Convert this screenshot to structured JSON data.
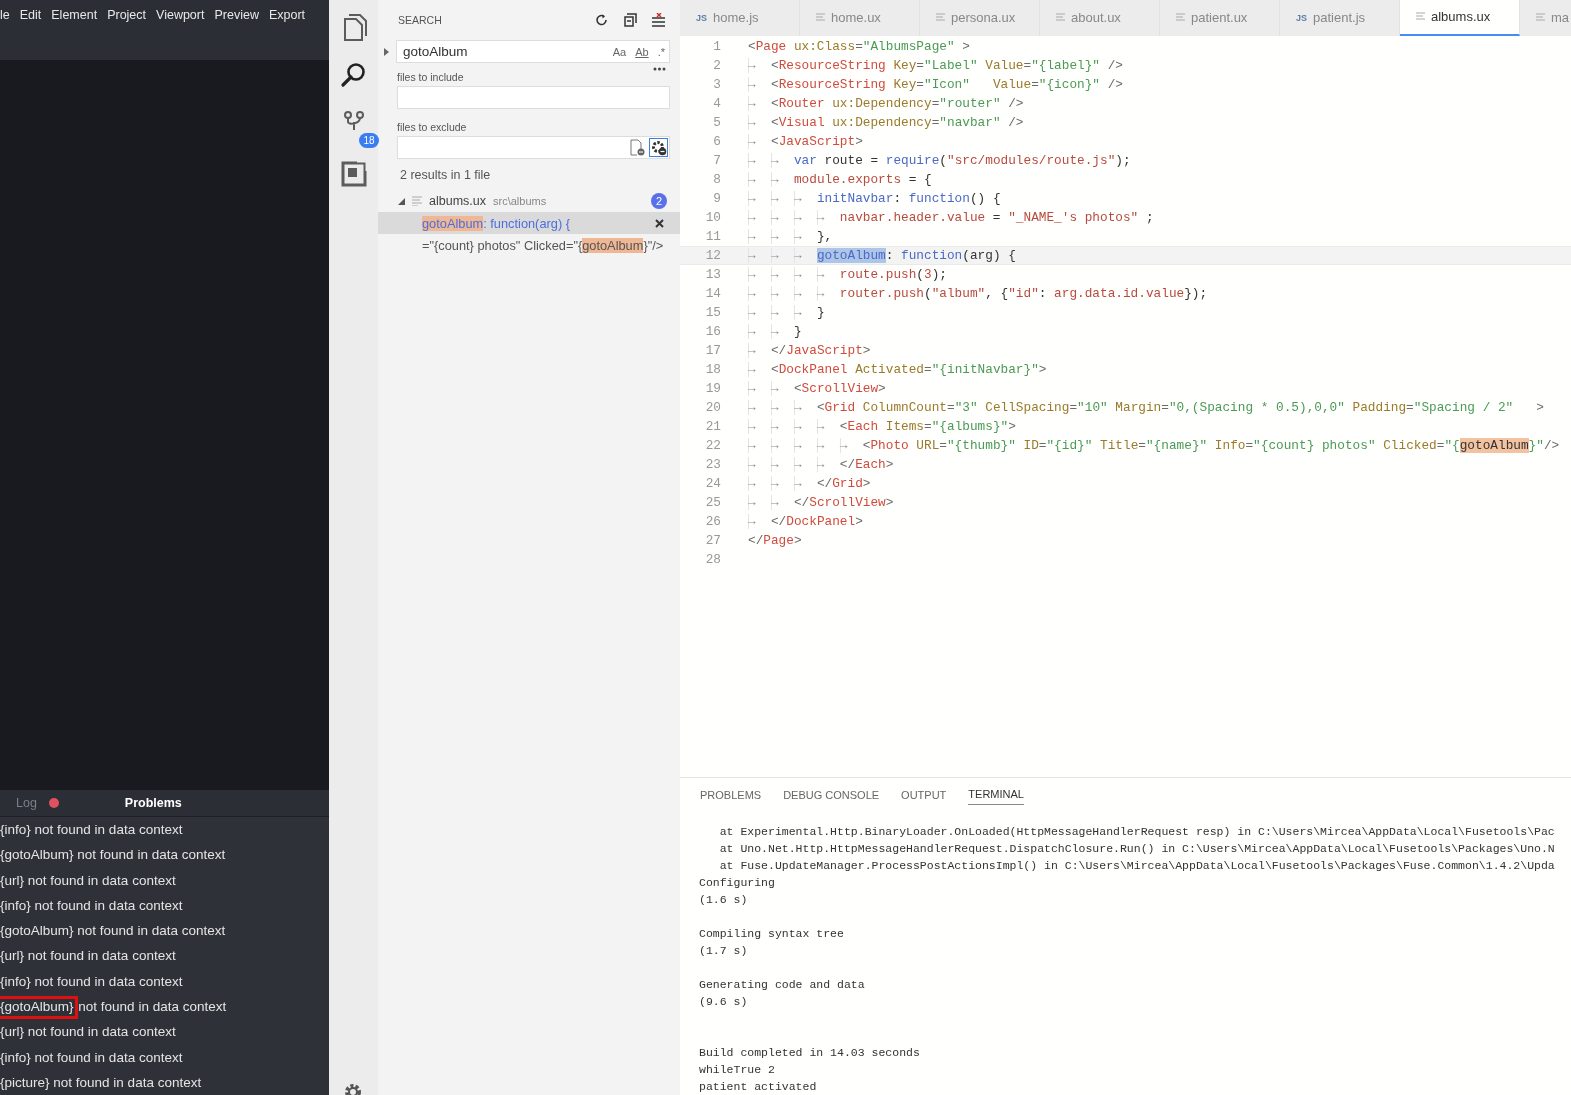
{
  "designer": {
    "menu": [
      {
        "label": "le"
      },
      {
        "label": "Edit"
      },
      {
        "label": "Element"
      },
      {
        "label": "Project"
      },
      {
        "label": "Viewport"
      },
      {
        "label": "Preview"
      },
      {
        "label": "Export"
      }
    ],
    "panel_tabs": [
      {
        "label": "Log",
        "selected": false,
        "unread": true
      },
      {
        "label": "Problems",
        "selected": true,
        "unread": false
      }
    ],
    "messages": [
      {
        "ref": "{info}",
        "text": "not found in data context",
        "marked": false
      },
      {
        "ref": "{gotoAlbum}",
        "text": "not found in data context",
        "marked": false
      },
      {
        "ref": "{url}",
        "text": "not found in data context",
        "marked": false
      },
      {
        "ref": "{info}",
        "text": "not found in data context",
        "marked": false
      },
      {
        "ref": "{gotoAlbum}",
        "text": "not found in data context",
        "marked": false
      },
      {
        "ref": "{url}",
        "text": "not found in data context",
        "marked": false
      },
      {
        "ref": "{info}",
        "text": "not found in data context",
        "marked": false
      },
      {
        "ref": "{gotoAlbum}",
        "text": "not found in data context",
        "marked": true
      },
      {
        "ref": "{url}",
        "text": "not found in data context",
        "marked": false
      },
      {
        "ref": "{info}",
        "text": "not found in data context",
        "marked": false
      },
      {
        "ref": "{picture}",
        "text": "not found in data context",
        "marked": false
      }
    ]
  },
  "activity_bar": [
    {
      "kind": "files",
      "selected": false
    },
    {
      "kind": "search",
      "selected": true
    },
    {
      "kind": "git",
      "selected": false,
      "badge": "18"
    },
    {
      "kind": "extensions",
      "selected": false
    }
  ],
  "search": {
    "title": "SEARCH",
    "query": "gotoAlbum",
    "options": [
      {
        "label": "Aa",
        "kind": "case"
      },
      {
        "label": "Ab",
        "kind": "word"
      },
      {
        "label": ".*",
        "kind": "regex"
      }
    ],
    "include_label": "files to include",
    "exclude_label": "files to exclude",
    "exclude_settings_selected": true,
    "summary": "2 results in 1 file",
    "results": [
      {
        "file": "albums.ux",
        "path": "src\\albums",
        "count": "2",
        "expanded": true,
        "matches": [
          {
            "match": "gotoAlbum",
            "after": ": function(arg) {",
            "selected": true
          },
          {
            "before": "=\"{count} photos\" Clicked=\"{",
            "match": "gotoAlbum",
            "after": "}\"/>",
            "selected": false
          }
        ]
      }
    ]
  },
  "editor": {
    "tabs": [
      {
        "label": "home.js",
        "badge": "JS",
        "selected": false
      },
      {
        "label": "home.ux",
        "selected": false
      },
      {
        "label": "persona.ux",
        "selected": false
      },
      {
        "label": "about.ux",
        "selected": false
      },
      {
        "label": "patient.ux",
        "selected": false
      },
      {
        "label": "patient.js",
        "badge": "JS",
        "selected": false
      },
      {
        "label": "albums.ux",
        "selected": true
      },
      {
        "label": "ma",
        "selected": false
      }
    ],
    "lines": [
      {
        "number": "1",
        "current": false,
        "tokens": [
          {
            "kind": "punct",
            "text": "<"
          },
          {
            "kind": "tag",
            "text": "Page"
          },
          {
            "kind": "attr",
            "text": " ux:Class"
          },
          {
            "kind": "punct",
            "text": "="
          },
          {
            "kind": "string",
            "text": "\"AlbumsPage\""
          },
          {
            "kind": "punct",
            "text": " >"
          }
        ]
      },
      {
        "number": "2",
        "current": false,
        "tokens": [
          {
            "kind": "indent",
            "text": "→"
          },
          {
            "kind": "punct",
            "text": "<"
          },
          {
            "kind": "tag",
            "text": "ResourceString"
          },
          {
            "kind": "attr",
            "text": " Key"
          },
          {
            "kind": "punct",
            "text": "="
          },
          {
            "kind": "string",
            "text": "\"Label\""
          },
          {
            "kind": "attr",
            "text": " Value"
          },
          {
            "kind": "punct",
            "text": "="
          },
          {
            "kind": "string",
            "text": "\"{label}\""
          },
          {
            "kind": "punct",
            "text": " />"
          }
        ]
      },
      {
        "number": "3",
        "current": false,
        "tokens": [
          {
            "kind": "indent",
            "text": "→"
          },
          {
            "kind": "punct",
            "text": "<"
          },
          {
            "kind": "tag",
            "text": "ResourceString"
          },
          {
            "kind": "attr",
            "text": " Key"
          },
          {
            "kind": "punct",
            "text": "="
          },
          {
            "kind": "string",
            "text": "\"Icon\""
          },
          {
            "kind": "attr",
            "text": "   Value"
          },
          {
            "kind": "punct",
            "text": "="
          },
          {
            "kind": "string",
            "text": "\"{icon}\""
          },
          {
            "kind": "punct",
            "text": " />"
          }
        ]
      },
      {
        "number": "4",
        "current": false,
        "tokens": [
          {
            "kind": "indent",
            "text": "→"
          },
          {
            "kind": "punct",
            "text": "<"
          },
          {
            "kind": "tag",
            "text": "Router"
          },
          {
            "kind": "attr",
            "text": " ux:Dependency"
          },
          {
            "kind": "punct",
            "text": "="
          },
          {
            "kind": "string",
            "text": "\"router\""
          },
          {
            "kind": "punct",
            "text": " />"
          }
        ]
      },
      {
        "number": "5",
        "current": false,
        "tokens": [
          {
            "kind": "indent",
            "text": "→"
          },
          {
            "kind": "punct",
            "text": "<"
          },
          {
            "kind": "tag",
            "text": "Visual"
          },
          {
            "kind": "attr",
            "text": " ux:Dependency"
          },
          {
            "kind": "punct",
            "text": "="
          },
          {
            "kind": "string",
            "text": "\"navbar\""
          },
          {
            "kind": "punct",
            "text": " />"
          }
        ]
      },
      {
        "number": "6",
        "current": false,
        "tokens": [
          {
            "kind": "indent",
            "text": "→"
          },
          {
            "kind": "punct",
            "text": "<"
          },
          {
            "kind": "tag",
            "text": "JavaScript"
          },
          {
            "kind": "punct",
            "text": ">"
          }
        ]
      },
      {
        "number": "7",
        "current": false,
        "tokens": [
          {
            "kind": "indent",
            "text": "→  →"
          },
          {
            "kind": "keyword",
            "text": "var"
          },
          {
            "kind": "plain",
            "text": " route = "
          },
          {
            "kind": "keyword",
            "text": "require"
          },
          {
            "kind": "plain",
            "text": "("
          },
          {
            "kind": "jsvalue",
            "text": "\"src/modules/route.js\""
          },
          {
            "kind": "plain",
            "text": ");"
          }
        ]
      },
      {
        "number": "8",
        "current": false,
        "tokens": [
          {
            "kind": "indent",
            "text": "→  →"
          },
          {
            "kind": "jsvalue",
            "text": "module.exports"
          },
          {
            "kind": "plain",
            "text": " = {"
          }
        ]
      },
      {
        "number": "9",
        "current": false,
        "tokens": [
          {
            "kind": "indent",
            "text": "→  →  →"
          },
          {
            "kind": "keyword",
            "text": "initNavbar"
          },
          {
            "kind": "plain",
            "text": ": "
          },
          {
            "kind": "keyword",
            "text": "function"
          },
          {
            "kind": "plain",
            "text": "() {"
          }
        ]
      },
      {
        "number": "10",
        "current": false,
        "tokens": [
          {
            "kind": "indent",
            "text": "→  →  →  →"
          },
          {
            "kind": "jsvalue",
            "text": "navbar.header.value"
          },
          {
            "kind": "plain",
            "text": " = "
          },
          {
            "kind": "jsvalue",
            "text": "\"_NAME_'s photos\""
          },
          {
            "kind": "plain",
            "text": " ;"
          }
        ]
      },
      {
        "number": "11",
        "current": false,
        "tokens": [
          {
            "kind": "indent",
            "text": "→  →  →"
          },
          {
            "kind": "plain",
            "text": "},"
          }
        ]
      },
      {
        "number": "12",
        "current": true,
        "tokens": [
          {
            "kind": "indent",
            "text": "→  →  →"
          },
          {
            "kind": "selected-match",
            "text": "gotoAlbum"
          },
          {
            "kind": "plain",
            "text": ": "
          },
          {
            "kind": "keyword",
            "text": "function"
          },
          {
            "kind": "plain",
            "text": "(arg) {"
          }
        ]
      },
      {
        "number": "13",
        "current": false,
        "tokens": [
          {
            "kind": "indent",
            "text": "→  →  →  →"
          },
          {
            "kind": "jsvalue",
            "text": "route.push"
          },
          {
            "kind": "plain",
            "text": "("
          },
          {
            "kind": "jsvalue",
            "text": "3"
          },
          {
            "kind": "plain",
            "text": ");"
          }
        ]
      },
      {
        "number": "14",
        "current": false,
        "tokens": [
          {
            "kind": "indent",
            "text": "→  →  →  →"
          },
          {
            "kind": "jsvalue",
            "text": "router.push"
          },
          {
            "kind": "plain",
            "text": "("
          },
          {
            "kind": "jsvalue",
            "text": "\"album\""
          },
          {
            "kind": "plain",
            "text": ", {"
          },
          {
            "kind": "jsvalue",
            "text": "\"id\""
          },
          {
            "kind": "plain",
            "text": ": "
          },
          {
            "kind": "jsvalue",
            "text": "arg.data.id.value"
          },
          {
            "kind": "plain",
            "text": "});"
          }
        ]
      },
      {
        "number": "15",
        "current": false,
        "tokens": [
          {
            "kind": "indent",
            "text": "→  →  →"
          },
          {
            "kind": "plain",
            "text": "}"
          }
        ]
      },
      {
        "number": "16",
        "current": false,
        "tokens": [
          {
            "kind": "indent",
            "text": "→  →"
          },
          {
            "kind": "plain",
            "text": "}"
          }
        ]
      },
      {
        "number": "17",
        "current": false,
        "tokens": [
          {
            "kind": "indent",
            "text": "→"
          },
          {
            "kind": "punct",
            "text": "</"
          },
          {
            "kind": "tag",
            "text": "JavaScript"
          },
          {
            "kind": "punct",
            "text": ">"
          }
        ]
      },
      {
        "number": "18",
        "current": false,
        "tokens": [
          {
            "kind": "indent",
            "text": "→"
          },
          {
            "kind": "punct",
            "text": "<"
          },
          {
            "kind": "tag",
            "text": "DockPanel"
          },
          {
            "kind": "attr",
            "text": " Activated"
          },
          {
            "kind": "punct",
            "text": "="
          },
          {
            "kind": "string",
            "text": "\"{initNavbar}\""
          },
          {
            "kind": "punct",
            "text": ">"
          }
        ]
      },
      {
        "number": "19",
        "current": false,
        "tokens": [
          {
            "kind": "indent",
            "text": "→  →"
          },
          {
            "kind": "punct",
            "text": "<"
          },
          {
            "kind": "tag",
            "text": "ScrollView"
          },
          {
            "kind": "punct",
            "text": ">"
          }
        ]
      },
      {
        "number": "20",
        "current": false,
        "tokens": [
          {
            "kind": "indent",
            "text": "→  →  →"
          },
          {
            "kind": "punct",
            "text": "<"
          },
          {
            "kind": "tag",
            "text": "Grid"
          },
          {
            "kind": "attr",
            "text": " ColumnCount"
          },
          {
            "kind": "punct",
            "text": "="
          },
          {
            "kind": "string",
            "text": "\"3\""
          },
          {
            "kind": "attr",
            "text": " CellSpacing"
          },
          {
            "kind": "punct",
            "text": "="
          },
          {
            "kind": "string",
            "text": "\"10\""
          },
          {
            "kind": "attr",
            "text": " Margin"
          },
          {
            "kind": "punct",
            "text": "="
          },
          {
            "kind": "string",
            "text": "\"0,(Spacing * 0.5),0,0\""
          },
          {
            "kind": "attr",
            "text": " Padding"
          },
          {
            "kind": "punct",
            "text": "="
          },
          {
            "kind": "string",
            "text": "\"Spacing / 2\""
          },
          {
            "kind": "punct",
            "text": "   >"
          }
        ]
      },
      {
        "number": "21",
        "current": false,
        "tokens": [
          {
            "kind": "indent",
            "text": "→  →  →  →"
          },
          {
            "kind": "punct",
            "text": "<"
          },
          {
            "kind": "tag",
            "text": "Each"
          },
          {
            "kind": "attr",
            "text": " Items"
          },
          {
            "kind": "punct",
            "text": "="
          },
          {
            "kind": "string",
            "text": "\"{albums}\""
          },
          {
            "kind": "punct",
            "text": ">"
          }
        ]
      },
      {
        "number": "22",
        "current": false,
        "tokens": [
          {
            "kind": "indent",
            "text": "→  →  →  →  →"
          },
          {
            "kind": "punct",
            "text": "<"
          },
          {
            "kind": "tag",
            "text": "Photo"
          },
          {
            "kind": "attr",
            "text": " URL"
          },
          {
            "kind": "punct",
            "text": "="
          },
          {
            "kind": "string",
            "text": "\"{thumb}\""
          },
          {
            "kind": "attr",
            "text": " ID"
          },
          {
            "kind": "punct",
            "text": "="
          },
          {
            "kind": "string",
            "text": "\"{id}\""
          },
          {
            "kind": "attr",
            "text": " Title"
          },
          {
            "kind": "punct",
            "text": "="
          },
          {
            "kind": "string",
            "text": "\"{name}\""
          },
          {
            "kind": "attr",
            "text": " Info"
          },
          {
            "kind": "punct",
            "text": "="
          },
          {
            "kind": "string",
            "text": "\"{count} photos\""
          },
          {
            "kind": "attr",
            "text": " Clicked"
          },
          {
            "kind": "punct",
            "text": "="
          },
          {
            "kind": "string",
            "text": "\"{"
          },
          {
            "kind": "match",
            "text": "gotoAlbum"
          },
          {
            "kind": "string",
            "text": "}\""
          },
          {
            "kind": "punct",
            "text": "/>"
          }
        ]
      },
      {
        "number": "23",
        "current": false,
        "tokens": [
          {
            "kind": "indent",
            "text": "→  →  →  →"
          },
          {
            "kind": "punct",
            "text": "</"
          },
          {
            "kind": "tag",
            "text": "Each"
          },
          {
            "kind": "punct",
            "text": ">"
          }
        ]
      },
      {
        "number": "24",
        "current": false,
        "tokens": [
          {
            "kind": "indent",
            "text": "→  →  →"
          },
          {
            "kind": "punct",
            "text": "</"
          },
          {
            "kind": "tag",
            "text": "Grid"
          },
          {
            "kind": "punct",
            "text": ">"
          }
        ]
      },
      {
        "number": "25",
        "current": false,
        "tokens": [
          {
            "kind": "indent",
            "text": "→  →"
          },
          {
            "kind": "punct",
            "text": "</"
          },
          {
            "kind": "tag",
            "text": "ScrollView"
          },
          {
            "kind": "punct",
            "text": ">"
          }
        ]
      },
      {
        "number": "26",
        "current": false,
        "tokens": [
          {
            "kind": "indent",
            "text": "→"
          },
          {
            "kind": "punct",
            "text": "</"
          },
          {
            "kind": "tag",
            "text": "DockPanel"
          },
          {
            "kind": "punct",
            "text": ">"
          }
        ]
      },
      {
        "number": "27",
        "current": false,
        "tokens": [
          {
            "kind": "punct",
            "text": "</"
          },
          {
            "kind": "tag",
            "text": "Page"
          },
          {
            "kind": "punct",
            "text": ">"
          }
        ]
      },
      {
        "number": "28",
        "current": false
      }
    ]
  },
  "panel": {
    "tabs": [
      {
        "label": "PROBLEMS",
        "selected": false
      },
      {
        "label": "DEBUG CONSOLE",
        "selected": false
      },
      {
        "label": "OUTPUT",
        "selected": false
      },
      {
        "label": "TERMINAL",
        "selected": true
      }
    ],
    "terminal": "   at Experimental.Http.BinaryLoader.OnLoaded(HttpMessageHandlerRequest resp) in C:\\Users\\Mircea\\AppData\\Local\\Fusetools\\Pac\n   at Uno.Net.Http.HttpMessageHandlerRequest.DispatchClosure.Run() in C:\\Users\\Mircea\\AppData\\Local\\Fusetools\\Packages\\Uno.N\n   at Fuse.UpdateManager.ProcessPostActionsImpl() in C:\\Users\\Mircea\\AppData\\Local\\Fusetools\\Packages\\Fuse.Common\\1.4.2\\Upda\nConfiguring\n(1.6 s)\n\nCompiling syntax tree\n(1.7 s)\n\nGenerating code and data\n(9.6 s)\n\n\nBuild completed in 14.03 seconds\nwhileTrue 2\npatient activated"
  }
}
